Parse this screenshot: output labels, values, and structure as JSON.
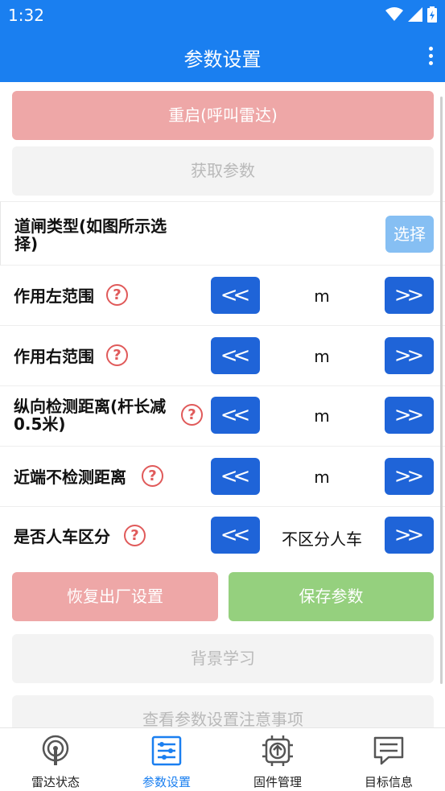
{
  "status": {
    "time": "1:32"
  },
  "appbar": {
    "title": "参数设置"
  },
  "buttons": {
    "restart": "重启(呼叫雷达)",
    "get_params": "获取参数",
    "restore": "恢复出厂设置",
    "save": "保存参数",
    "background_learning": "背景学习",
    "view_notes": "查看参数设置注意事项"
  },
  "gate": {
    "label": "道闸类型(如图所示选择)",
    "select": "选择"
  },
  "rows": [
    {
      "label": "作用左范围",
      "value": "m"
    },
    {
      "label": "作用右范围",
      "value": "m"
    },
    {
      "label": "纵向检测距离(杆长减0.5米)",
      "value": "m"
    },
    {
      "label": "近端不检测距离",
      "value": "m"
    },
    {
      "label": "是否人车区分",
      "value": "不区分人车"
    }
  ],
  "help_glyph": "?",
  "arrows": {
    "left": "<<",
    "right": ">>"
  },
  "nav": [
    {
      "label": "雷达状态",
      "icon": "radar-icon"
    },
    {
      "label": "参数设置",
      "icon": "settings-sliders-icon"
    },
    {
      "label": "固件管理",
      "icon": "chip-upload-icon"
    },
    {
      "label": "目标信息",
      "icon": "message-icon"
    }
  ],
  "colors": {
    "primary": "#1a7ff0",
    "danger_light": "#eea7a7",
    "success_light": "#95d07e",
    "arrow_button": "#1f64d8"
  }
}
